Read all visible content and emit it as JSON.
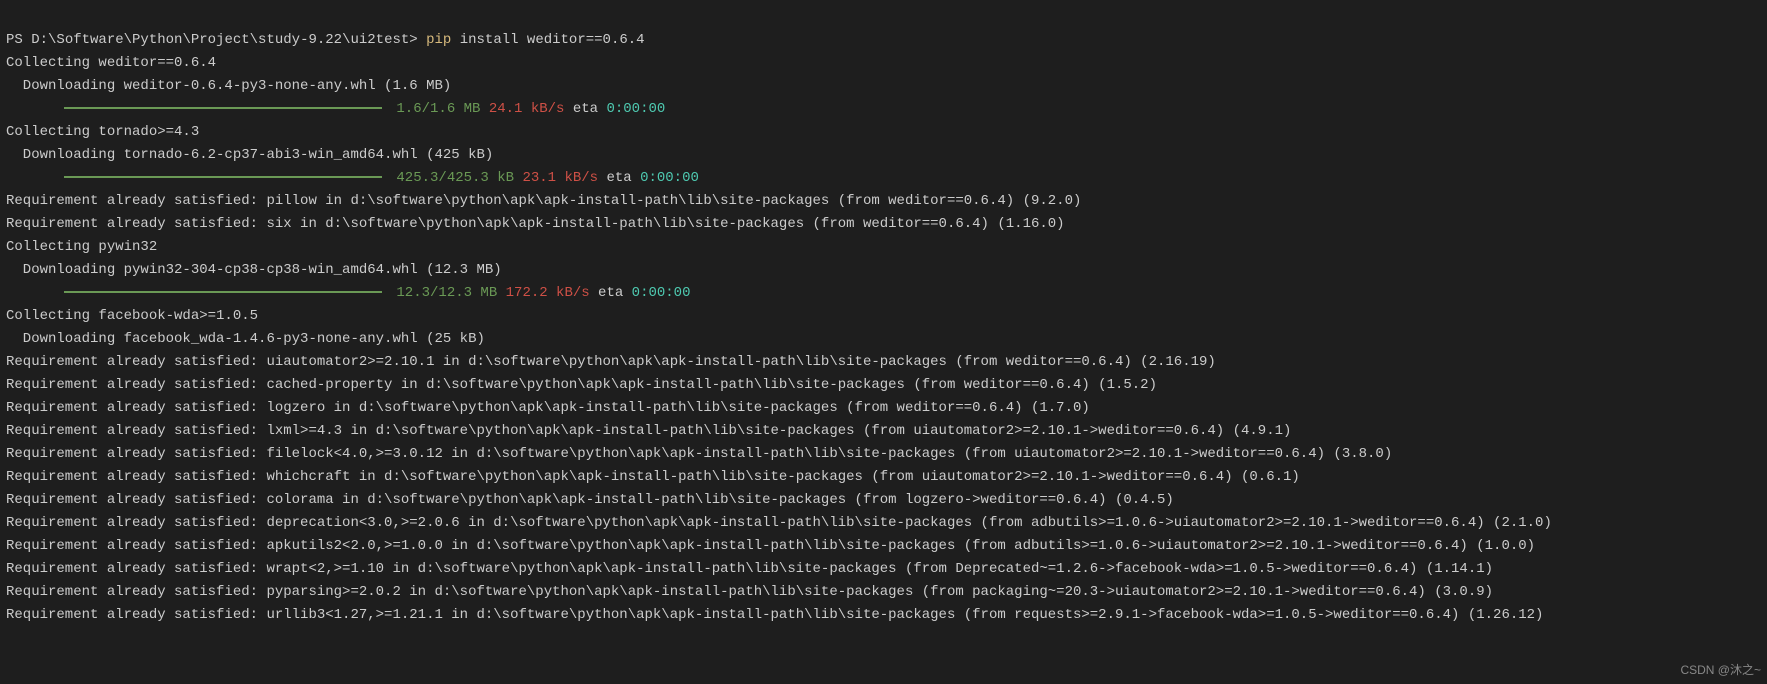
{
  "prompt_prefix": "PS ",
  "prompt_path": "D:\\Software\\Python\\Project\\study-9.22\\ui2test",
  "prompt_suffix": "> ",
  "command_pip": "pip",
  "command_args": " install weditor==0.6.4",
  "lines": {
    "collecting_weditor": "Collecting weditor==0.6.4",
    "dl_weditor": "  Downloading weditor-0.6.4-py3-none-any.whl (1.6 MB)",
    "bar1_size": "1.6/1.6 MB",
    "bar1_speed": "24.1 kB/s",
    "bar1_eta_label": " eta ",
    "bar1_eta": "0:00:00",
    "collecting_tornado": "Collecting tornado>=4.3",
    "dl_tornado": "  Downloading tornado-6.2-cp37-abi3-win_amd64.whl (425 kB)",
    "bar2_size": "425.3/425.3 kB",
    "bar2_speed": "23.1 kB/s",
    "bar2_eta_label": " eta ",
    "bar2_eta": "0:00:00",
    "req_pillow": "Requirement already satisfied: pillow in d:\\software\\python\\apk\\apk-install-path\\lib\\site-packages (from weditor==0.6.4) (9.2.0)",
    "req_six": "Requirement already satisfied: six in d:\\software\\python\\apk\\apk-install-path\\lib\\site-packages (from weditor==0.6.4) (1.16.0)",
    "collecting_pywin32": "Collecting pywin32",
    "dl_pywin32": "  Downloading pywin32-304-cp38-cp38-win_amd64.whl (12.3 MB)",
    "bar3_size": "12.3/12.3 MB",
    "bar3_speed": "172.2 kB/s",
    "bar3_eta_label": " eta ",
    "bar3_eta": "0:00:00",
    "collecting_wda": "Collecting facebook-wda>=1.0.5",
    "dl_wda": "  Downloading facebook_wda-1.4.6-py3-none-any.whl (25 kB)",
    "req_uia2": "Requirement already satisfied: uiautomator2>=2.10.1 in d:\\software\\python\\apk\\apk-install-path\\lib\\site-packages (from weditor==0.6.4) (2.16.19)",
    "req_cached": "Requirement already satisfied: cached-property in d:\\software\\python\\apk\\apk-install-path\\lib\\site-packages (from weditor==0.6.4) (1.5.2)",
    "req_logzero": "Requirement already satisfied: logzero in d:\\software\\python\\apk\\apk-install-path\\lib\\site-packages (from weditor==0.6.4) (1.7.0)",
    "req_lxml": "Requirement already satisfied: lxml>=4.3 in d:\\software\\python\\apk\\apk-install-path\\lib\\site-packages (from uiautomator2>=2.10.1->weditor==0.6.4) (4.9.1)",
    "req_filelock": "Requirement already satisfied: filelock<4.0,>=3.0.12 in d:\\software\\python\\apk\\apk-install-path\\lib\\site-packages (from uiautomator2>=2.10.1->weditor==0.6.4) (3.8.0)",
    "req_whichcraft": "Requirement already satisfied: whichcraft in d:\\software\\python\\apk\\apk-install-path\\lib\\site-packages (from uiautomator2>=2.10.1->weditor==0.6.4) (0.6.1)",
    "req_colorama": "Requirement already satisfied: colorama in d:\\software\\python\\apk\\apk-install-path\\lib\\site-packages (from logzero->weditor==0.6.4) (0.4.5)",
    "req_deprecation": "Requirement already satisfied: deprecation<3.0,>=2.0.6 in d:\\software\\python\\apk\\apk-install-path\\lib\\site-packages (from adbutils>=1.0.6->uiautomator2>=2.10.1->weditor==0.6.4) (2.1.0)",
    "req_apkutils2": "Requirement already satisfied: apkutils2<2.0,>=1.0.0 in d:\\software\\python\\apk\\apk-install-path\\lib\\site-packages (from adbutils>=1.0.6->uiautomator2>=2.10.1->weditor==0.6.4) (1.0.0)",
    "req_wrapt": "Requirement already satisfied: wrapt<2,>=1.10 in d:\\software\\python\\apk\\apk-install-path\\lib\\site-packages (from Deprecated~=1.2.6->facebook-wda>=1.0.5->weditor==0.6.4) (1.14.1)",
    "req_pyparsing": "Requirement already satisfied: pyparsing>=2.0.2 in d:\\software\\python\\apk\\apk-install-path\\lib\\site-packages (from packaging~=20.3->uiautomator2>=2.10.1->weditor==0.6.4) (3.0.9)",
    "req_urllib3": "Requirement already satisfied: urllib3<1.27,>=1.21.1 in d:\\software\\python\\apk\\apk-install-path\\lib\\site-packages (from requests>=2.9.1->facebook-wda>=1.0.5->weditor==0.6.4) (1.26.12)"
  },
  "watermark": "CSDN @沐之~"
}
